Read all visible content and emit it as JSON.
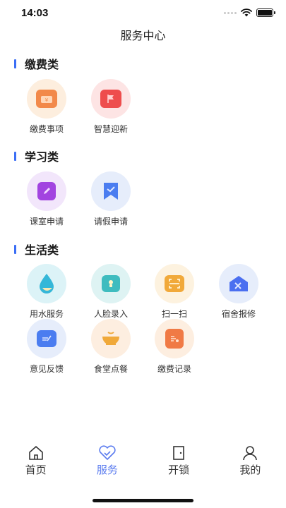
{
  "status": {
    "time": "14:03"
  },
  "page_title": "服务中心",
  "sections": [
    {
      "title": "缴费类",
      "items": [
        {
          "label": "缴费事项",
          "icon": "wallet-icon",
          "color": "#f2894a"
        },
        {
          "label": "智慧迎新",
          "icon": "flag-icon",
          "color": "#ee4d4d"
        }
      ]
    },
    {
      "title": "学习类",
      "items": [
        {
          "label": "课室申请",
          "icon": "pencil-icon",
          "color": "#a244e0"
        },
        {
          "label": "请假申请",
          "icon": "bookmark-icon",
          "color": "#4b7df0"
        }
      ]
    },
    {
      "title": "生活类",
      "items": [
        {
          "label": "用水服务",
          "icon": "water-drop-icon",
          "color": "#35b7d8"
        },
        {
          "label": "人脸录入",
          "icon": "face-id-icon",
          "color": "#3fbcbf"
        },
        {
          "label": "扫一扫",
          "icon": "scan-icon",
          "color": "#f1a93a"
        },
        {
          "label": "宿舍报修",
          "icon": "dorm-repair-icon",
          "color": "#4b6ff0"
        },
        {
          "label": "意见反馈",
          "icon": "feedback-icon",
          "color": "#4b7df0"
        },
        {
          "label": "食堂点餐",
          "icon": "food-bowl-icon",
          "color": "#f0a93a"
        },
        {
          "label": "缴费记录",
          "icon": "receipt-icon",
          "color": "#f07a45"
        }
      ]
    }
  ],
  "tabs": [
    {
      "label": "首页",
      "icon": "home-icon",
      "active": false
    },
    {
      "label": "服务",
      "icon": "heart-icon",
      "active": true
    },
    {
      "label": "开锁",
      "icon": "door-icon",
      "active": false
    },
    {
      "label": "我的",
      "icon": "user-icon",
      "active": false
    }
  ],
  "colors": {
    "accent": "#5a7bef",
    "section_bar": "#3b6ef5"
  }
}
